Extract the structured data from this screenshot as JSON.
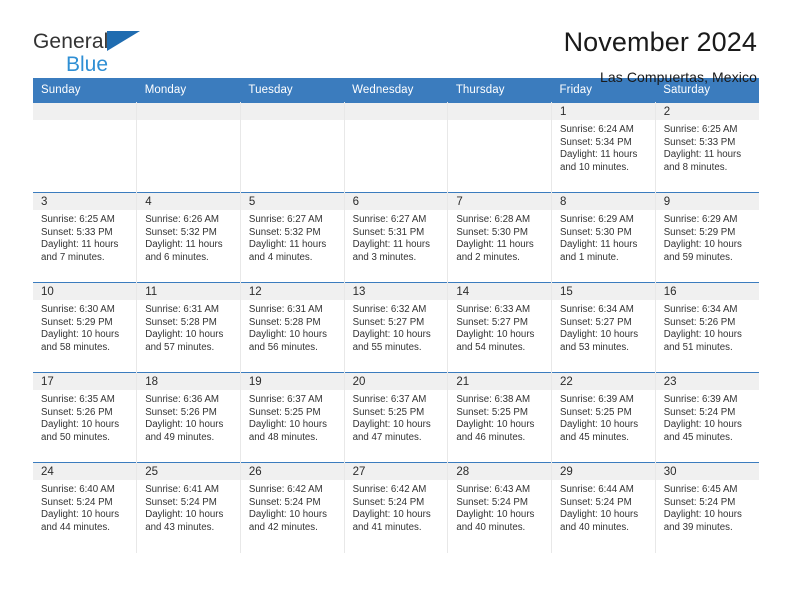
{
  "brand": {
    "line1": "General",
    "line2": "Blue",
    "triangle_color": "#1f6cb0",
    "line2_color": "#2f8fd4"
  },
  "header": {
    "title": "November 2024",
    "subtitle": "Las Compuertas, Mexico"
  },
  "theme": {
    "header_blue": "#3b7cbe",
    "daynum_band": "#f0f0f0",
    "text": "#333333"
  },
  "weekdays": [
    "Sunday",
    "Monday",
    "Tuesday",
    "Wednesday",
    "Thursday",
    "Friday",
    "Saturday"
  ],
  "labels": {
    "sunrise": "Sunrise:",
    "sunset": "Sunset:",
    "daylight": "Daylight:"
  },
  "weeks": [
    [
      {
        "day": ""
      },
      {
        "day": ""
      },
      {
        "day": ""
      },
      {
        "day": ""
      },
      {
        "day": ""
      },
      {
        "day": "1",
        "sunrise": "Sunrise: 6:24 AM",
        "sunset": "Sunset: 5:34 PM",
        "daylight_l1": "Daylight: 11 hours",
        "daylight_l2": "and 10 minutes."
      },
      {
        "day": "2",
        "sunrise": "Sunrise: 6:25 AM",
        "sunset": "Sunset: 5:33 PM",
        "daylight_l1": "Daylight: 11 hours",
        "daylight_l2": "and 8 minutes."
      }
    ],
    [
      {
        "day": "3",
        "sunrise": "Sunrise: 6:25 AM",
        "sunset": "Sunset: 5:33 PM",
        "daylight_l1": "Daylight: 11 hours",
        "daylight_l2": "and 7 minutes."
      },
      {
        "day": "4",
        "sunrise": "Sunrise: 6:26 AM",
        "sunset": "Sunset: 5:32 PM",
        "daylight_l1": "Daylight: 11 hours",
        "daylight_l2": "and 6 minutes."
      },
      {
        "day": "5",
        "sunrise": "Sunrise: 6:27 AM",
        "sunset": "Sunset: 5:32 PM",
        "daylight_l1": "Daylight: 11 hours",
        "daylight_l2": "and 4 minutes."
      },
      {
        "day": "6",
        "sunrise": "Sunrise: 6:27 AM",
        "sunset": "Sunset: 5:31 PM",
        "daylight_l1": "Daylight: 11 hours",
        "daylight_l2": "and 3 minutes."
      },
      {
        "day": "7",
        "sunrise": "Sunrise: 6:28 AM",
        "sunset": "Sunset: 5:30 PM",
        "daylight_l1": "Daylight: 11 hours",
        "daylight_l2": "and 2 minutes."
      },
      {
        "day": "8",
        "sunrise": "Sunrise: 6:29 AM",
        "sunset": "Sunset: 5:30 PM",
        "daylight_l1": "Daylight: 11 hours",
        "daylight_l2": "and 1 minute."
      },
      {
        "day": "9",
        "sunrise": "Sunrise: 6:29 AM",
        "sunset": "Sunset: 5:29 PM",
        "daylight_l1": "Daylight: 10 hours",
        "daylight_l2": "and 59 minutes."
      }
    ],
    [
      {
        "day": "10",
        "sunrise": "Sunrise: 6:30 AM",
        "sunset": "Sunset: 5:29 PM",
        "daylight_l1": "Daylight: 10 hours",
        "daylight_l2": "and 58 minutes."
      },
      {
        "day": "11",
        "sunrise": "Sunrise: 6:31 AM",
        "sunset": "Sunset: 5:28 PM",
        "daylight_l1": "Daylight: 10 hours",
        "daylight_l2": "and 57 minutes."
      },
      {
        "day": "12",
        "sunrise": "Sunrise: 6:31 AM",
        "sunset": "Sunset: 5:28 PM",
        "daylight_l1": "Daylight: 10 hours",
        "daylight_l2": "and 56 minutes."
      },
      {
        "day": "13",
        "sunrise": "Sunrise: 6:32 AM",
        "sunset": "Sunset: 5:27 PM",
        "daylight_l1": "Daylight: 10 hours",
        "daylight_l2": "and 55 minutes."
      },
      {
        "day": "14",
        "sunrise": "Sunrise: 6:33 AM",
        "sunset": "Sunset: 5:27 PM",
        "daylight_l1": "Daylight: 10 hours",
        "daylight_l2": "and 54 minutes."
      },
      {
        "day": "15",
        "sunrise": "Sunrise: 6:34 AM",
        "sunset": "Sunset: 5:27 PM",
        "daylight_l1": "Daylight: 10 hours",
        "daylight_l2": "and 53 minutes."
      },
      {
        "day": "16",
        "sunrise": "Sunrise: 6:34 AM",
        "sunset": "Sunset: 5:26 PM",
        "daylight_l1": "Daylight: 10 hours",
        "daylight_l2": "and 51 minutes."
      }
    ],
    [
      {
        "day": "17",
        "sunrise": "Sunrise: 6:35 AM",
        "sunset": "Sunset: 5:26 PM",
        "daylight_l1": "Daylight: 10 hours",
        "daylight_l2": "and 50 minutes."
      },
      {
        "day": "18",
        "sunrise": "Sunrise: 6:36 AM",
        "sunset": "Sunset: 5:26 PM",
        "daylight_l1": "Daylight: 10 hours",
        "daylight_l2": "and 49 minutes."
      },
      {
        "day": "19",
        "sunrise": "Sunrise: 6:37 AM",
        "sunset": "Sunset: 5:25 PM",
        "daylight_l1": "Daylight: 10 hours",
        "daylight_l2": "and 48 minutes."
      },
      {
        "day": "20",
        "sunrise": "Sunrise: 6:37 AM",
        "sunset": "Sunset: 5:25 PM",
        "daylight_l1": "Daylight: 10 hours",
        "daylight_l2": "and 47 minutes."
      },
      {
        "day": "21",
        "sunrise": "Sunrise: 6:38 AM",
        "sunset": "Sunset: 5:25 PM",
        "daylight_l1": "Daylight: 10 hours",
        "daylight_l2": "and 46 minutes."
      },
      {
        "day": "22",
        "sunrise": "Sunrise: 6:39 AM",
        "sunset": "Sunset: 5:25 PM",
        "daylight_l1": "Daylight: 10 hours",
        "daylight_l2": "and 45 minutes."
      },
      {
        "day": "23",
        "sunrise": "Sunrise: 6:39 AM",
        "sunset": "Sunset: 5:24 PM",
        "daylight_l1": "Daylight: 10 hours",
        "daylight_l2": "and 45 minutes."
      }
    ],
    [
      {
        "day": "24",
        "sunrise": "Sunrise: 6:40 AM",
        "sunset": "Sunset: 5:24 PM",
        "daylight_l1": "Daylight: 10 hours",
        "daylight_l2": "and 44 minutes."
      },
      {
        "day": "25",
        "sunrise": "Sunrise: 6:41 AM",
        "sunset": "Sunset: 5:24 PM",
        "daylight_l1": "Daylight: 10 hours",
        "daylight_l2": "and 43 minutes."
      },
      {
        "day": "26",
        "sunrise": "Sunrise: 6:42 AM",
        "sunset": "Sunset: 5:24 PM",
        "daylight_l1": "Daylight: 10 hours",
        "daylight_l2": "and 42 minutes."
      },
      {
        "day": "27",
        "sunrise": "Sunrise: 6:42 AM",
        "sunset": "Sunset: 5:24 PM",
        "daylight_l1": "Daylight: 10 hours",
        "daylight_l2": "and 41 minutes."
      },
      {
        "day": "28",
        "sunrise": "Sunrise: 6:43 AM",
        "sunset": "Sunset: 5:24 PM",
        "daylight_l1": "Daylight: 10 hours",
        "daylight_l2": "and 40 minutes."
      },
      {
        "day": "29",
        "sunrise": "Sunrise: 6:44 AM",
        "sunset": "Sunset: 5:24 PM",
        "daylight_l1": "Daylight: 10 hours",
        "daylight_l2": "and 40 minutes."
      },
      {
        "day": "30",
        "sunrise": "Sunrise: 6:45 AM",
        "sunset": "Sunset: 5:24 PM",
        "daylight_l1": "Daylight: 10 hours",
        "daylight_l2": "and 39 minutes."
      }
    ]
  ]
}
